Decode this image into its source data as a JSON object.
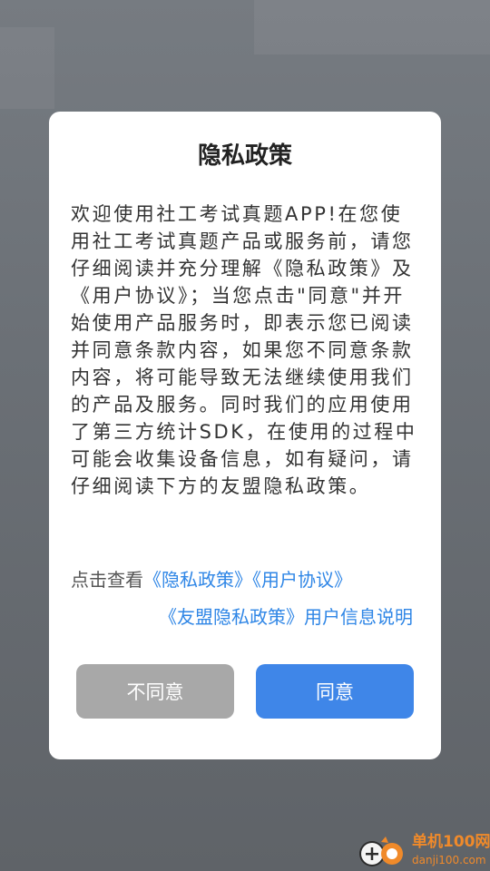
{
  "dialog": {
    "title": "隐私政策",
    "body": "欢迎使用社工考试真题APP!在您使用社工考试真题产品或服务前，请您仔细阅读并充分理解《隐私政策》及《用户协议》；当您点击\"同意\"并开始使用产品服务时，即表示您已阅读并同意条款内容，如果您不同意条款内容，将可能导致无法继续使用我们的产品及服务。同时我们的应用使用了第三方统计SDK，在使用的过程中可能会收集设备信息，如有疑问，请仔细阅读下方的友盟隐私政策。",
    "links": {
      "prefix": "点击查看",
      "privacy_policy": "《隐私政策》",
      "user_agreement": "《用户协议》",
      "umeng_privacy": "《友盟隐私政策》",
      "user_info": "用户信息说明"
    },
    "buttons": {
      "disagree": "不同意",
      "agree": "同意"
    }
  },
  "watermark": {
    "name": "单机100网",
    "url": "danji100.com"
  },
  "colors": {
    "link": "#2f86e6",
    "agree_button": "#3f86e8",
    "disagree_button": "#a8a8a8",
    "watermark": "#f08a2a"
  }
}
